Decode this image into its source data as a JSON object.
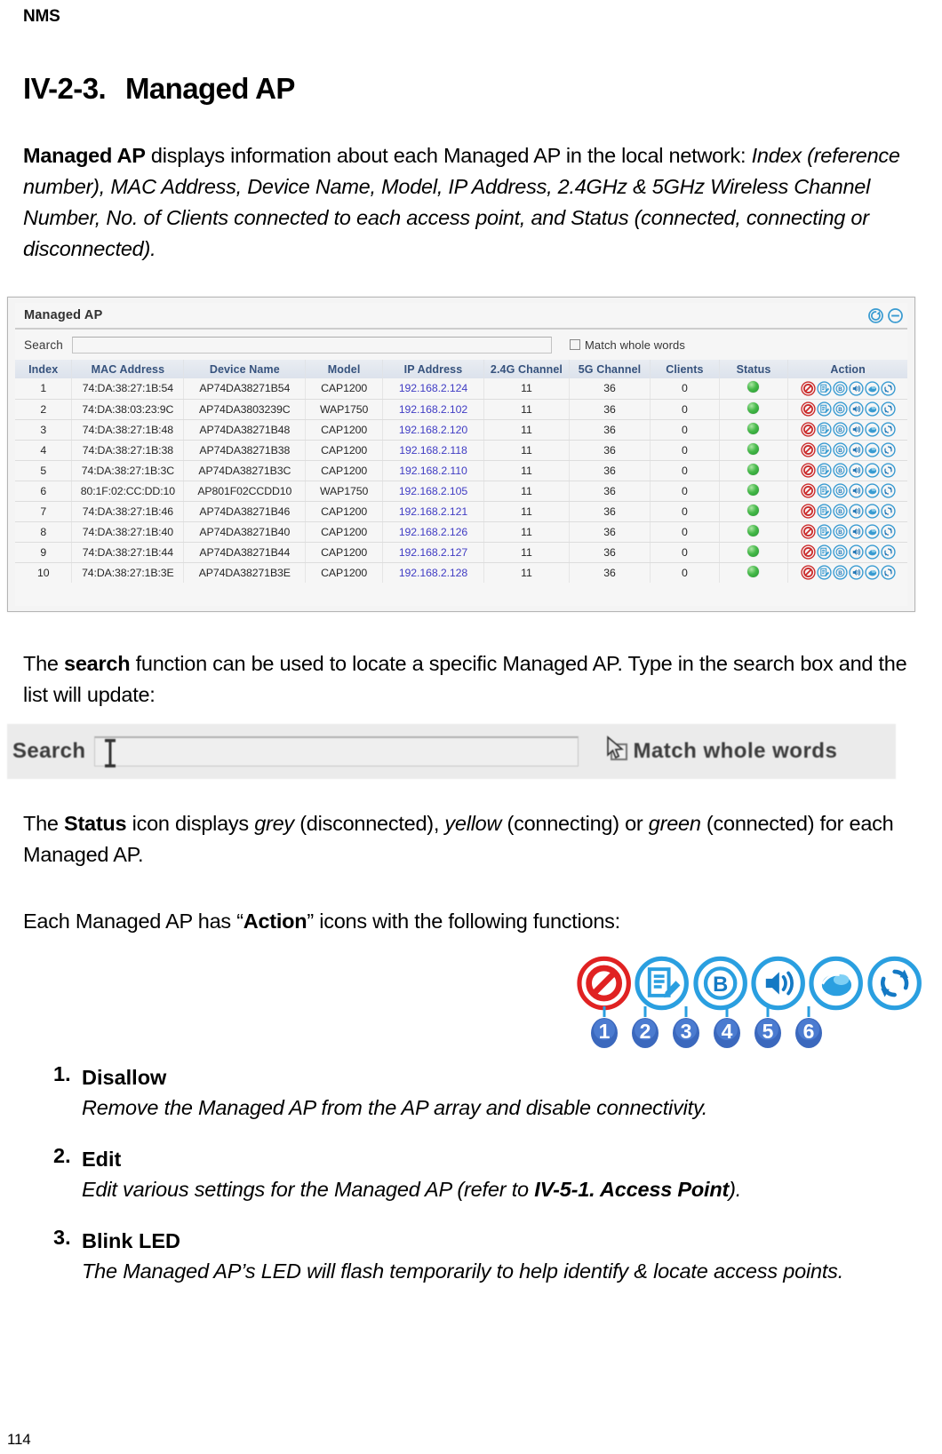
{
  "running_header": "NMS",
  "heading": {
    "number": "IV-2-3.",
    "title": "Managed AP"
  },
  "intro": {
    "bold_lead": "Managed AP",
    "text_1": " displays information about each Managed AP in the local network: ",
    "italic_1": "Index (reference number), MAC Address, Device Name, Model, IP Address, 2.4GHz & 5GHz Wireless Channel Number, No. of Clients connected to each access point, and Status (connected, connecting or disconnected)."
  },
  "screenshot": {
    "panel_title": "Managed AP",
    "refresh_icon": "refresh-icon",
    "minimize_icon": "minimize-icon",
    "search_label": "Search",
    "search_value": "",
    "search_placeholder": "",
    "match_whole_words_label": "Match whole words",
    "match_whole_words_checked": false,
    "columns": [
      "Index",
      "MAC Address",
      "Device Name",
      "Model",
      "IP Address",
      "2.4G Channel",
      "5G Channel",
      "Clients",
      "Status",
      "Action"
    ],
    "rows": [
      {
        "index": "1",
        "mac": "74:DA:38:27:1B:54",
        "device": "AP74DA38271B54",
        "model": "CAP1200",
        "ip": "192.168.2.124",
        "ch24": "11",
        "ch5": "36",
        "clients": "0",
        "status": "green"
      },
      {
        "index": "2",
        "mac": "74:DA:38:03:23:9C",
        "device": "AP74DA3803239C",
        "model": "WAP1750",
        "ip": "192.168.2.102",
        "ch24": "11",
        "ch5": "36",
        "clients": "0",
        "status": "green"
      },
      {
        "index": "3",
        "mac": "74:DA:38:27:1B:48",
        "device": "AP74DA38271B48",
        "model": "CAP1200",
        "ip": "192.168.2.120",
        "ch24": "11",
        "ch5": "36",
        "clients": "0",
        "status": "green"
      },
      {
        "index": "4",
        "mac": "74:DA:38:27:1B:38",
        "device": "AP74DA38271B38",
        "model": "CAP1200",
        "ip": "192.168.2.118",
        "ch24": "11",
        "ch5": "36",
        "clients": "0",
        "status": "green"
      },
      {
        "index": "5",
        "mac": "74:DA:38:27:1B:3C",
        "device": "AP74DA38271B3C",
        "model": "CAP1200",
        "ip": "192.168.2.110",
        "ch24": "11",
        "ch5": "36",
        "clients": "0",
        "status": "green"
      },
      {
        "index": "6",
        "mac": "80:1F:02:CC:DD:10",
        "device": "AP801F02CCDD10",
        "model": "WAP1750",
        "ip": "192.168.2.105",
        "ch24": "11",
        "ch5": "36",
        "clients": "0",
        "status": "green"
      },
      {
        "index": "7",
        "mac": "74:DA:38:27:1B:46",
        "device": "AP74DA38271B46",
        "model": "CAP1200",
        "ip": "192.168.2.121",
        "ch24": "11",
        "ch5": "36",
        "clients": "0",
        "status": "green"
      },
      {
        "index": "8",
        "mac": "74:DA:38:27:1B:40",
        "device": "AP74DA38271B40",
        "model": "CAP1200",
        "ip": "192.168.2.126",
        "ch24": "11",
        "ch5": "36",
        "clients": "0",
        "status": "green"
      },
      {
        "index": "9",
        "mac": "74:DA:38:27:1B:44",
        "device": "AP74DA38271B44",
        "model": "CAP1200",
        "ip": "192.168.2.127",
        "ch24": "11",
        "ch5": "36",
        "clients": "0",
        "status": "green"
      },
      {
        "index": "10",
        "mac": "74:DA:38:27:1B:3E",
        "device": "AP74DA38271B3E",
        "model": "CAP1200",
        "ip": "192.168.2.128",
        "ch24": "11",
        "ch5": "36",
        "clients": "0",
        "status": "green"
      }
    ],
    "action_icons": [
      "disallow-icon",
      "edit-icon",
      "blink-led-icon",
      "speaker-icon",
      "network-icon",
      "refresh-arrows-icon"
    ]
  },
  "search_para": {
    "part_1": "The ",
    "bold_1": "search",
    "part_2": " function can be used to locate a specific Managed AP. Type in the search box and the list will update:"
  },
  "search_shot": {
    "label": "Search",
    "value": "",
    "match_whole_words_label": "Match whole words",
    "text_cursor_icon": "i-beam-cursor-icon",
    "pointer_icon": "mouse-pointer-icon"
  },
  "status_para": {
    "part_1": "The ",
    "bold_1": "Status",
    "part_2": " icon displays ",
    "italic_1": "grey",
    "part_3": " (disconnected), ",
    "italic_2": "yellow",
    "part_4": " (connecting) or ",
    "italic_3": "green",
    "part_5": " (connected) for each Managed AP."
  },
  "action_para": {
    "part_1": "Each Managed AP has “",
    "bold_1": "Action",
    "part_2": "” icons with the following functions:"
  },
  "legend": {
    "icons": [
      "disallow-icon",
      "edit-icon",
      "blink-led-icon",
      "speaker-icon",
      "network-icon",
      "refresh-arrows-icon"
    ],
    "numbers": [
      "1",
      "2",
      "3",
      "4",
      "5",
      "6"
    ]
  },
  "functions": [
    {
      "num": "1.",
      "title": "Disallow",
      "desc": "Remove the Managed AP from the AP array and disable connectivity.",
      "desc_bold": "",
      "desc_tail": ""
    },
    {
      "num": "2.",
      "title": "Edit",
      "desc": "Edit various settings for the Managed AP (refer to ",
      "desc_bold": "IV-5-1. Access Point",
      "desc_tail": ")."
    },
    {
      "num": "3.",
      "title": "Blink LED",
      "desc": "The Managed AP’s LED will flash temporarily to help identify & locate access points.",
      "desc_bold": "",
      "desc_tail": ""
    }
  ],
  "page_number": "114"
}
